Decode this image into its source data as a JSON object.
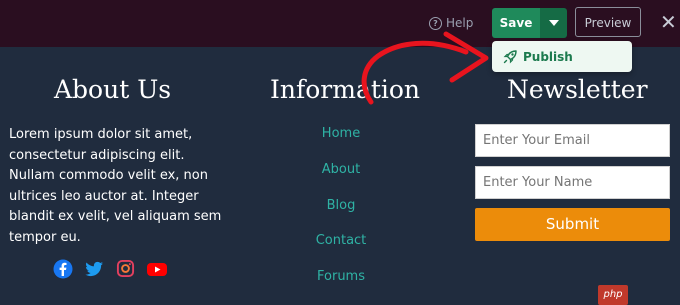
{
  "toolbar": {
    "help_label": "Help",
    "save_label": "Save",
    "preview_label": "Preview",
    "close_glyph": "✕",
    "help_glyph": "?",
    "colors": {
      "bar_bg": "#2a0e20",
      "save_bg": "#1f8a5b",
      "save_caret_bg": "#156b45"
    }
  },
  "dropdown": {
    "publish_label": "Publish",
    "icon": "rocket-icon"
  },
  "footer": {
    "about": {
      "title": "About Us",
      "text": "Lorem ipsum dolor sit amet, consectetur adipiscing elit. Nullam commodo velit ex, non ultrices leo auctor at. Integer blandit ex velit, vel aliquam sem tempor eu.",
      "social": [
        "facebook-icon",
        "twitter-icon",
        "instagram-icon",
        "youtube-icon"
      ]
    },
    "information": {
      "title": "Information",
      "links": [
        "Home",
        "About",
        "Blog",
        "Contact",
        "Forums"
      ]
    },
    "newsletter": {
      "title": "Newsletter",
      "email_placeholder": "Enter Your Email",
      "name_placeholder": "Enter Your Name",
      "submit_label": "Submit"
    },
    "colors": {
      "bg": "#202c3e",
      "link": "#2fb3a5",
      "submit": "#ec8c0a"
    }
  },
  "watermark": {
    "text": "php"
  }
}
